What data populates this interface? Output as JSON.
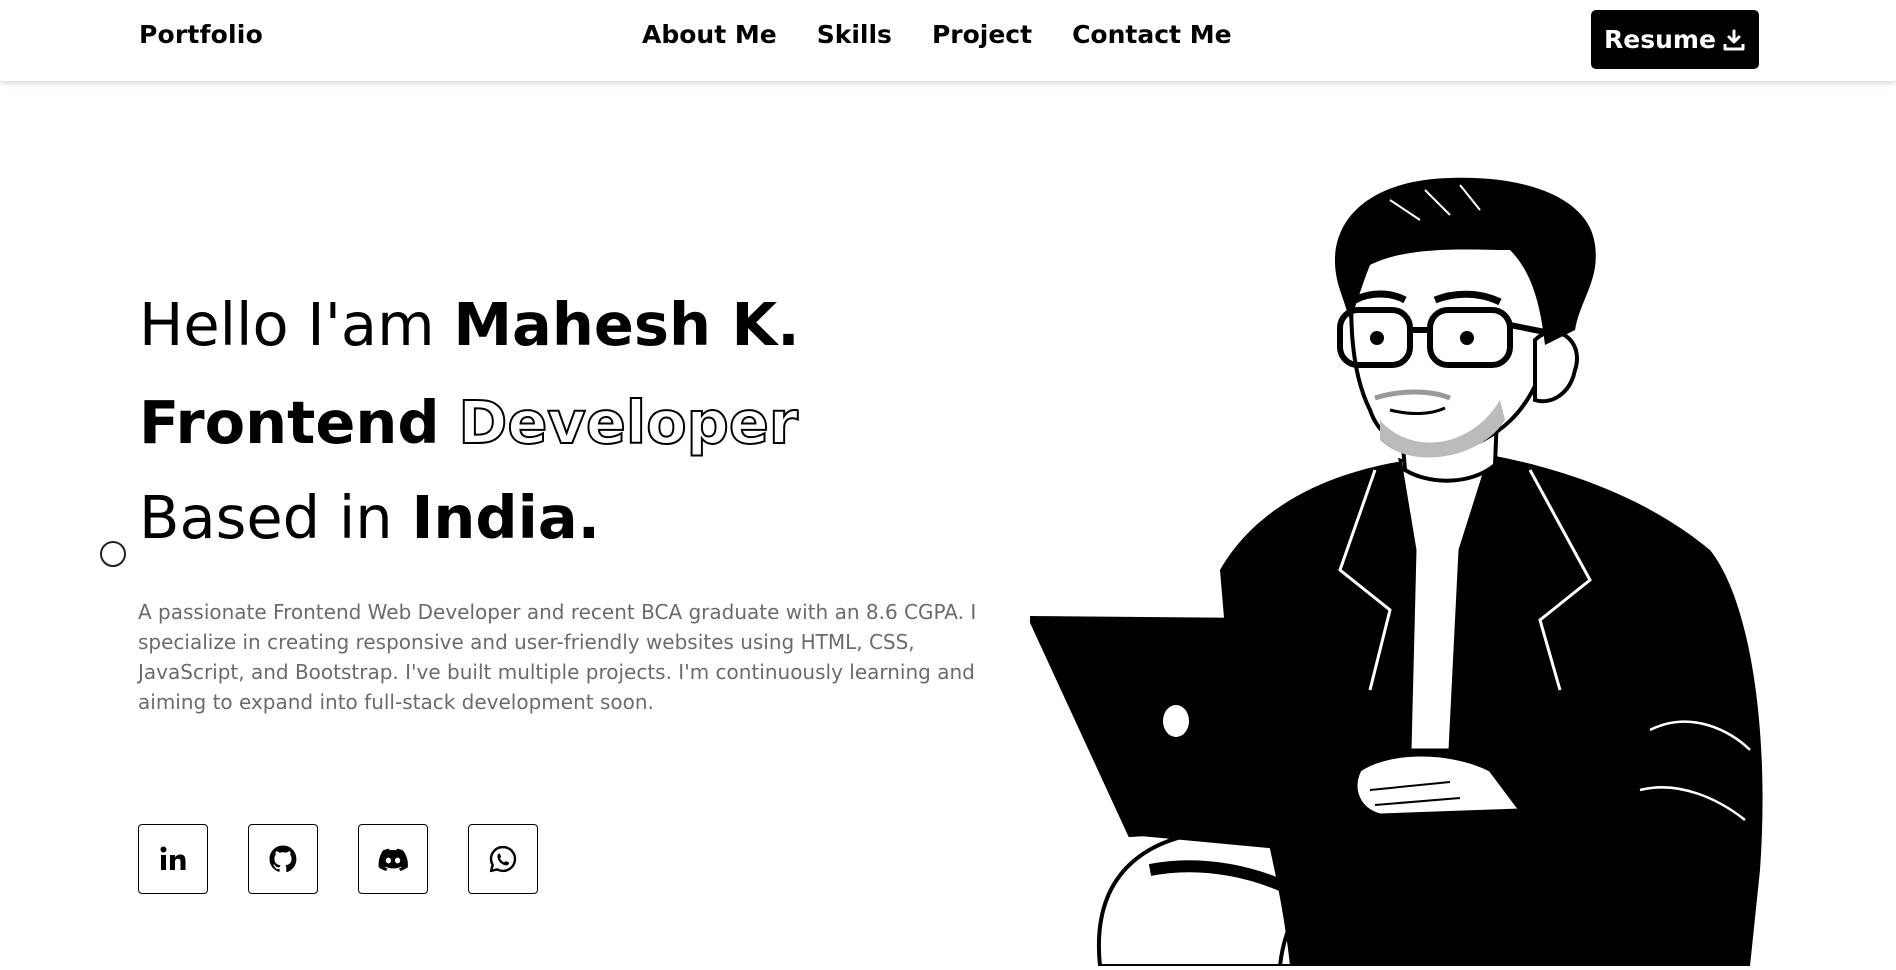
{
  "nav": {
    "brand": "Portfolio",
    "links": [
      "About Me",
      "Skills",
      "Project",
      "Contact Me"
    ],
    "resume_label": "Resume"
  },
  "hero": {
    "line1_light": "Hello I'am",
    "line1_bold": "Mahesh K.",
    "line2_bold": "Frontend",
    "line2_outline": "Developer",
    "line3_light": "Based in",
    "line3_bold": "India.",
    "description": "A passionate Frontend Web Developer and recent BCA graduate with an 8.6 CGPA. I specialize in creating responsive and user-friendly websites using HTML, CSS, JavaScript, and Bootstrap. I've built multiple projects. I'm continuously learning and aiming to expand into full-stack development soon."
  },
  "socials": [
    {
      "icon": "linkedin-icon"
    },
    {
      "icon": "github-icon"
    },
    {
      "icon": "discord-icon"
    },
    {
      "icon": "whatsapp-icon"
    }
  ],
  "colors": {
    "primary": "#000000",
    "background": "#ffffff",
    "muted_text": "#6b6b6b"
  }
}
